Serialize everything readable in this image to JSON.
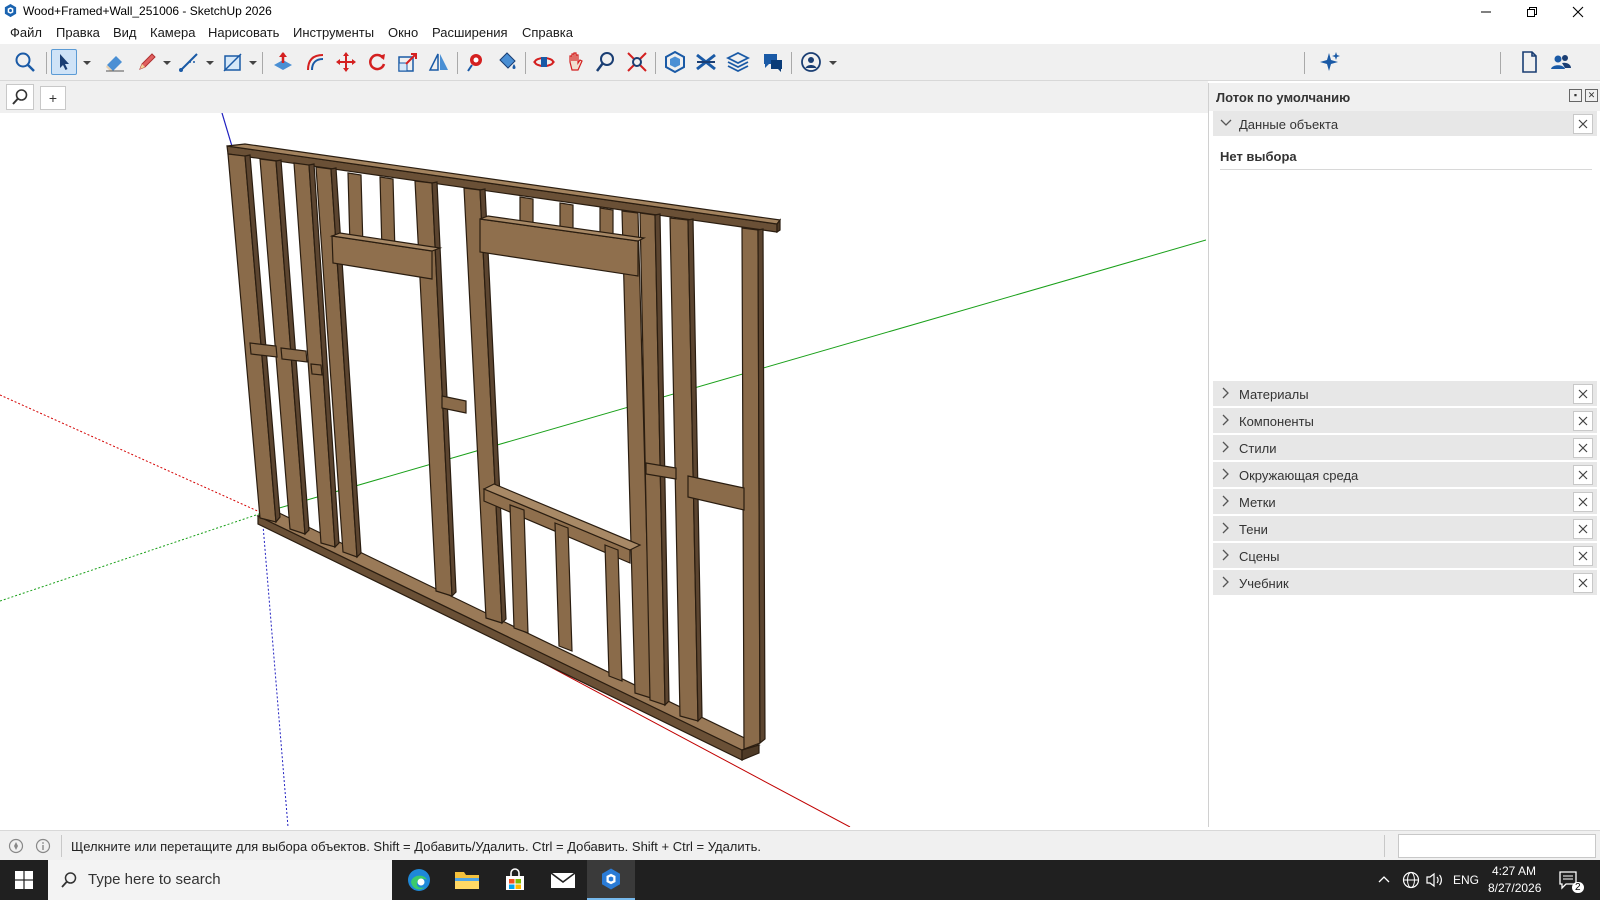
{
  "window": {
    "title": "Wood+Framed+Wall_251006 - SketchUp 2026"
  },
  "menu": [
    "Файл",
    "Правка",
    "Вид",
    "Камера",
    "Нарисовать",
    "Инструменты",
    "Окно",
    "Расширения",
    "Справка"
  ],
  "toolbar": {
    "tools": [
      "search-tool",
      "select-tool",
      "eraser-tool",
      "pencil-tool",
      "line-tool",
      "rectangle-tool",
      "push-pull-tool",
      "offset-tool",
      "move-tool",
      "rotate-tool",
      "scale-tool",
      "follow-me-tool",
      "tape-tool",
      "paint-tool",
      "orbit-tool",
      "pan-tool",
      "zoom-tool",
      "zoom-extents-tool",
      "warehouse-tool",
      "extension-tool",
      "layers-tool",
      "chat-tool",
      "account-tool",
      "ai-tool",
      "new-doc-tool",
      "collaborate-tool"
    ],
    "selected_tool": "select-tool"
  },
  "search_row": {
    "add_label": "+"
  },
  "tray": {
    "title": "Лоток по умолчанию",
    "entity_info": {
      "label": "Данные объекта",
      "content": "Нет выбора"
    },
    "panels": [
      "Материалы",
      "Компоненты",
      "Стили",
      "Окружающая среда",
      "Метки",
      "Тени",
      "Сцены",
      "Учебник"
    ]
  },
  "status": {
    "text": "Щелкните или перетащите для выбора объектов. Shift = Добавить/Удалить. Ctrl = Добавить. Shift + Ctrl = Удалить.",
    "measurements": ""
  },
  "taskbar": {
    "search_placeholder": "Type here to search",
    "language": "ENG",
    "time": "4:27 AM",
    "date": "8/27/2026",
    "notifications": "2"
  },
  "colors": {
    "wood": "#8a6b4a",
    "wood_dark": "#4e3a26",
    "axis_red": "#d40000",
    "axis_green": "#1aa01a",
    "axis_blue": "#2020c0",
    "accent": "#0078d7"
  }
}
